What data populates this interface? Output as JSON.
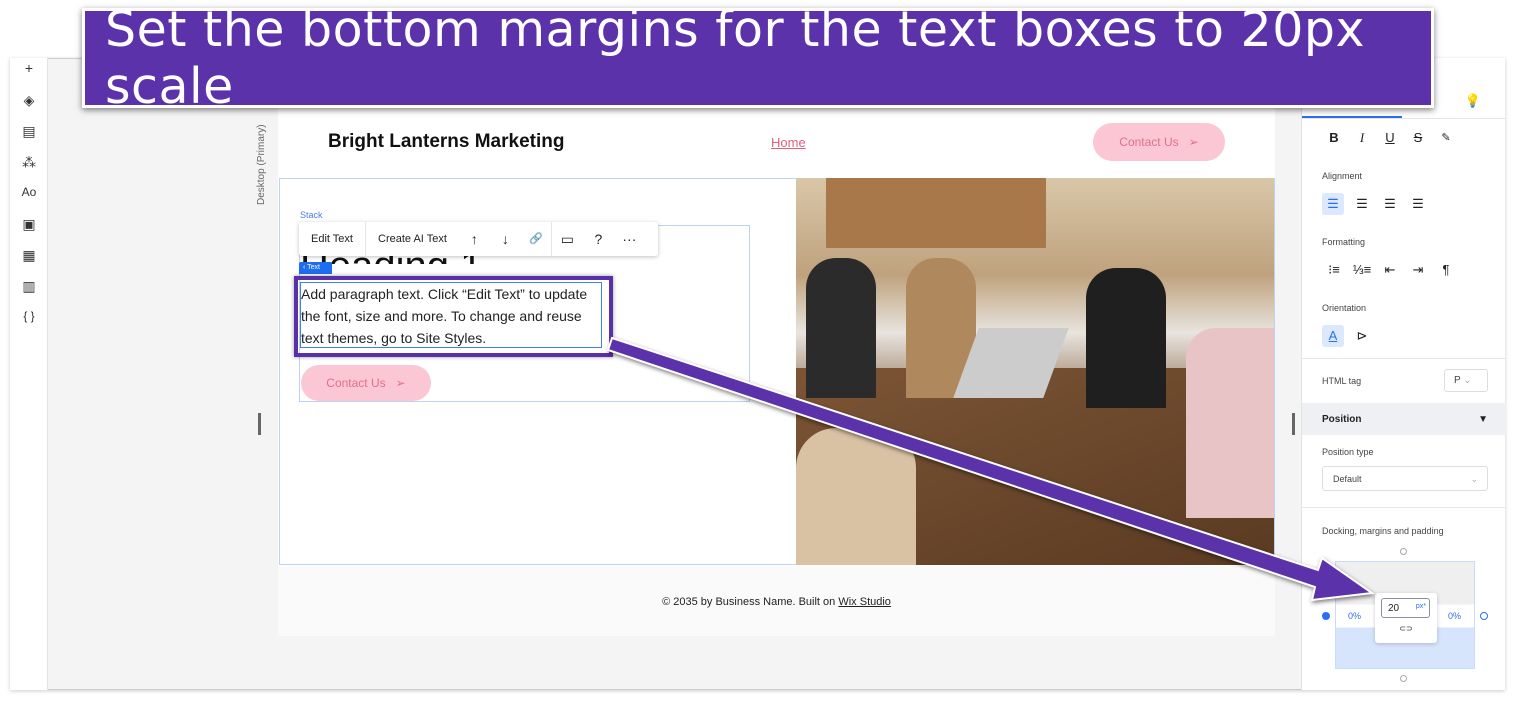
{
  "banner": {
    "text": "Set the bottom margins for the text boxes to 20px scale"
  },
  "sidebar": {
    "icons": [
      "plus-icon",
      "layers-icon",
      "page-icon",
      "components-icon",
      "text-theme-icon",
      "media-icon",
      "apps-icon",
      "table-icon",
      "code-icon"
    ],
    "glyphs": [
      "+",
      "◈",
      "▤",
      "⁂",
      "Aᴏ",
      "▣",
      "▦",
      "▥",
      "{ }"
    ]
  },
  "canvas": {
    "viewport_label": "Desktop (Primary)"
  },
  "site": {
    "title": "Bright Lanterns Marketing",
    "nav_home": "Home",
    "contact": "Contact Us",
    "stack_label": "Stack",
    "heading": "Heading 1",
    "text_chip": "‹ Text",
    "paragraph": "Add paragraph text. Click “Edit Text” to update the font, size and more. To change and reuse text themes, go to Site Styles.",
    "footer_text": "© 2035 by Business Name. Built on ",
    "footer_link": "Wix Studio"
  },
  "toolbar": {
    "edit_text": "Edit Text",
    "create_ai_text": "Create AI Text",
    "move_up": "↑",
    "move_down": "↓",
    "link": "🔗",
    "comment": "▭",
    "help": "?",
    "more": "···"
  },
  "panel": {
    "bold": "B",
    "italic": "I",
    "underline": "U",
    "strike": "S",
    "highlight": "✎",
    "alignment": "Alignment",
    "formatting": "Formatting",
    "orientation": "Orientation",
    "html_tag": "HTML tag",
    "html_tag_value": "P",
    "position": "Position",
    "position_type": "Position type",
    "position_type_value": "Default",
    "docking": "Docking, margins and padding",
    "left_margin": "0%",
    "right_margin": "0%",
    "bottom_value": "20",
    "bottom_unit": "px*",
    "link_icon": "⊂⊃"
  },
  "colors": {
    "accent": "#5b32aa",
    "brand_blue": "#2a6ff0",
    "button_pink": "#fcc7d4"
  }
}
